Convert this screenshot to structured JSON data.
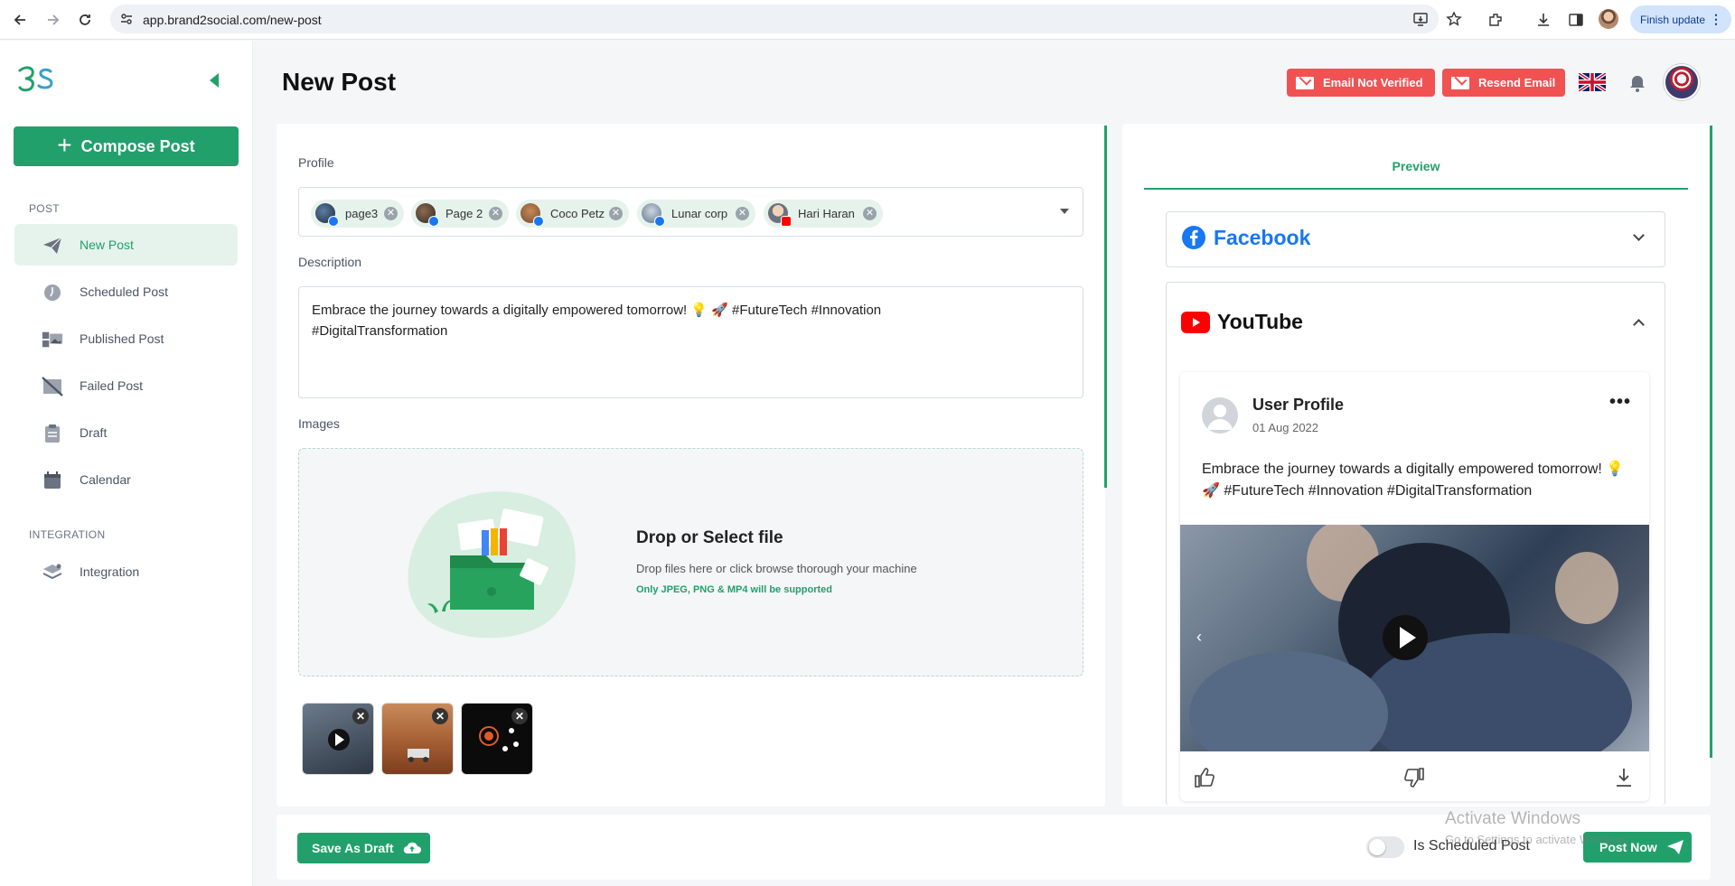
{
  "browser": {
    "url": "app.brand2social.com/new-post",
    "update_label": "Finish update"
  },
  "sidebar": {
    "compose_label": "Compose Post",
    "post_section": "POST",
    "integration_section": "INTEGRATION",
    "items": [
      {
        "label": "New Post",
        "icon": "paper-plane-icon",
        "active": true
      },
      {
        "label": "Scheduled Post",
        "icon": "clock-icon"
      },
      {
        "label": "Published Post",
        "icon": "gallery-icon"
      },
      {
        "label": "Failed Post",
        "icon": "image-off-icon"
      },
      {
        "label": "Draft",
        "icon": "clipboard-icon"
      },
      {
        "label": "Calendar",
        "icon": "calendar-icon"
      },
      {
        "label": "Integration",
        "icon": "layers-icon"
      }
    ]
  },
  "header": {
    "title": "New Post",
    "email_not_verified": "Email Not Verified",
    "resend_email": "Resend Email",
    "language_flag": "uk-flag-icon"
  },
  "form": {
    "profile_label": "Profile",
    "profiles": [
      {
        "name": "page3",
        "network": "facebook"
      },
      {
        "name": "Page 2",
        "network": "facebook"
      },
      {
        "name": "Coco Petz",
        "network": "facebook"
      },
      {
        "name": "Lunar corp",
        "network": "facebook"
      },
      {
        "name": "Hari Haran",
        "network": "youtube"
      }
    ],
    "description_label": "Description",
    "description_line1": "Embrace the journey towards a digitally empowered tomorrow! 💡 🚀 #FutureTech #Innovation",
    "description_line2": "#DigitalTransformation",
    "images_label": "Images",
    "drop_title": "Drop or Select file",
    "drop_sub": "Drop files here or click  browse  thorough your machine",
    "drop_note": "Only JPEG, PNG & MP4 will be supported"
  },
  "preview": {
    "tab": "Preview",
    "facebook": "Facebook",
    "youtube": "YouTube",
    "user": "User Profile",
    "date": "01 Aug 2022",
    "text": "Embrace the journey towards a digitally empowered tomorrow! 💡 🚀 #FutureTech #Innovation #DigitalTransformation"
  },
  "footer": {
    "save_draft": "Save As Draft",
    "scheduled_toggle": "Is Scheduled Post",
    "post_now": "Post Now"
  },
  "watermark": {
    "line1": "Activate Windows",
    "line2": "Go to Settings to activate Windows."
  },
  "colors": {
    "accent": "#22a06b",
    "danger": "#f05252",
    "facebook": "#1877f2",
    "youtube": "#ff0000"
  }
}
